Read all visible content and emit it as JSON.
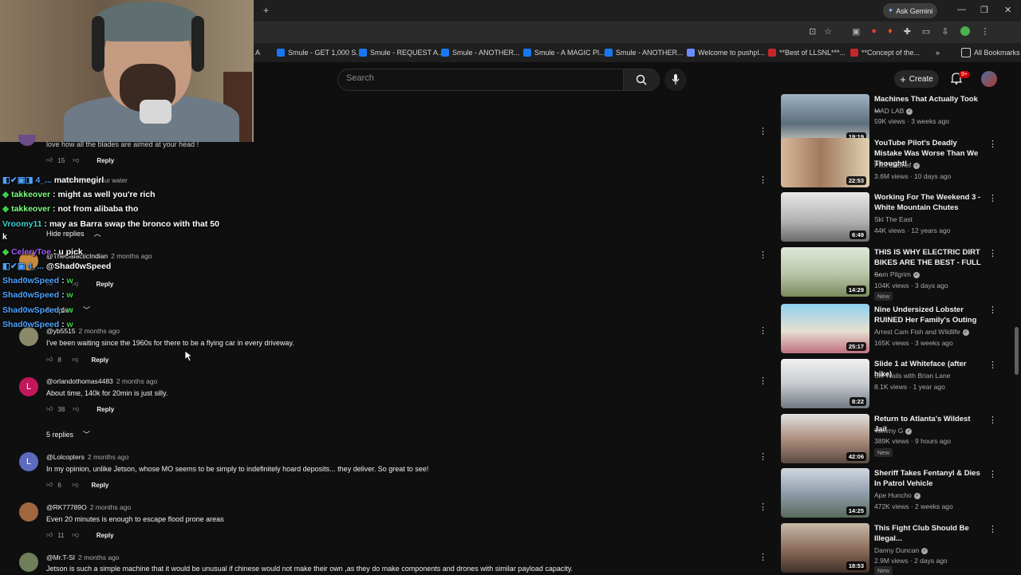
{
  "browser": {
    "ask_gemini": "Ask Gemini",
    "bookmark_first_fragment": "A",
    "bookmarks": [
      "Smule - GET 1,000 S...",
      "Smule - REQUEST A...",
      "Smule - ANOTHER...",
      "Smule - A MAGIC Pl...",
      "Smule - ANOTHER...",
      "Welcome to pushpl...",
      "**Best of LLSNL***...",
      "**Concept of the..."
    ],
    "all_bookmarks": "All Bookmarks",
    "new_tab": "+",
    "overflow": "»"
  },
  "header": {
    "search_placeholder": "Search",
    "create_label": "Create",
    "notification_badge": "9+"
  },
  "chat": [
    {
      "user": "",
      "message": ""
    },
    {
      "user": "takkeover",
      "message": "might as well you're rich"
    },
    {
      "user": "takkeover",
      "message": "not from alibaba tho"
    },
    {
      "user": "Vroomy11",
      "message": "may as Barra swap the bronco with that 50"
    },
    {
      "user": "",
      "message": "k"
    },
    {
      "user": "CeleryToe",
      "message": "u pick"
    },
    {
      "user": "",
      "message": "@Shad0wSpeed"
    },
    {
      "user": "Shad0wSpeed",
      "message": "w"
    },
    {
      "user": "Shad0wSpeed",
      "message": "w"
    },
    {
      "user": "Shad0wSpeed",
      "message": "w"
    },
    {
      "user": "Shad0wSpeed",
      "message": "w"
    }
  ],
  "chat_fragments": {
    "matchmegirl": "matchmegirl",
    "moneylikeyourwater": "Money like your water"
  },
  "comments": {
    "partial_top_text": "love how all the blades are aimed at your head !",
    "partial_top_likes": "15",
    "reply_label": "Reply",
    "hide_replies": "Hide replies",
    "replies_5": "5 replies",
    "items": [
      {
        "author": "@TheGalacticIndian",
        "ago": "2 months ago",
        "text": "",
        "likes": ""
      },
      {
        "author": "@yb5515",
        "ago": "2 months ago",
        "text": "I've been waiting since the 1960s for there to be a flying car in every driveway.",
        "likes": "8"
      },
      {
        "author": "@orlandothomas4483",
        "ago": "2 months ago",
        "text": "About time, 140k for 20min is just silly.",
        "likes": "38"
      },
      {
        "author": "@Lolcopters",
        "ago": "2 months ago",
        "text": "In my opinion, unlike Jetson, whose MO seems to be simply to indefinitely hoard deposits... they deliver. So great to see!",
        "likes": "6"
      },
      {
        "author": "@RK77789O",
        "ago": "2 months ago",
        "text": "Even 20 minutes is enough to escape flood prone areas",
        "likes": "11"
      },
      {
        "author": "@Mr.T-SI",
        "ago": "2 months ago",
        "text": "Jetson is such a simple machine that it would be unusual if chinese would not make their own ,as they do make components and drones with similar payload capacity.",
        "likes": ""
      }
    ],
    "avatar_letters": {
      "orlando": "L",
      "lolcopters": "L"
    }
  },
  "sidebar": [
    {
      "title": "Machines That Actually Took ...",
      "channel": "MAD LAB",
      "meta": "59K views · 3 weeks ago",
      "duration": "19:19",
      "new": ""
    },
    {
      "title": "YouTube Pilot's Deadly Mistake Was Worse Than We Thought!",
      "channel": "Pilot Debrief",
      "meta": "3.6M views · 10 days ago",
      "duration": "22:53",
      "new": ""
    },
    {
      "title": "Working For The Weekend 3 - White Mountain Chutes",
      "channel": "Ski The East",
      "meta": "44K views · 12 years ago",
      "duration": "6:49",
      "new": ""
    },
    {
      "title": "THIS IS WHY ELECTRIC DIRT BIKES ARE THE BEST - FULL ...",
      "channel": "Sam Pilgrim",
      "meta": "104K views · 3 days ago",
      "duration": "14:29",
      "new": "New"
    },
    {
      "title": "Nine Undersized Lobster RUINED Her Family's Outing",
      "channel": "Arrest Cam Fish and Wildlife",
      "meta": "165K views · 3 weeks ago",
      "duration": "25:17",
      "new": ""
    },
    {
      "title": "Slide 1 at Whiteface (after hike)",
      "channel": "Ski Trails with Brian Lane",
      "meta": "8.1K views · 1 year ago",
      "duration": "8:22",
      "new": ""
    },
    {
      "title": "Return to Atlanta's Wildest Jail",
      "channel": "Tommy G",
      "meta": "389K views · 9 hours ago",
      "duration": "42:06",
      "new": "New"
    },
    {
      "title": "Sheriff Takes Fentanyl & Dies In Patrol Vehicle",
      "channel": "Ape Huncho",
      "meta": "472K views · 2 weeks ago",
      "duration": "14:25",
      "new": ""
    },
    {
      "title": "This Fight Club Should Be Illegal...",
      "channel": "Danny Duncan",
      "meta": "2.9M views · 2 days ago",
      "duration": "18:53",
      "new": "New"
    }
  ]
}
